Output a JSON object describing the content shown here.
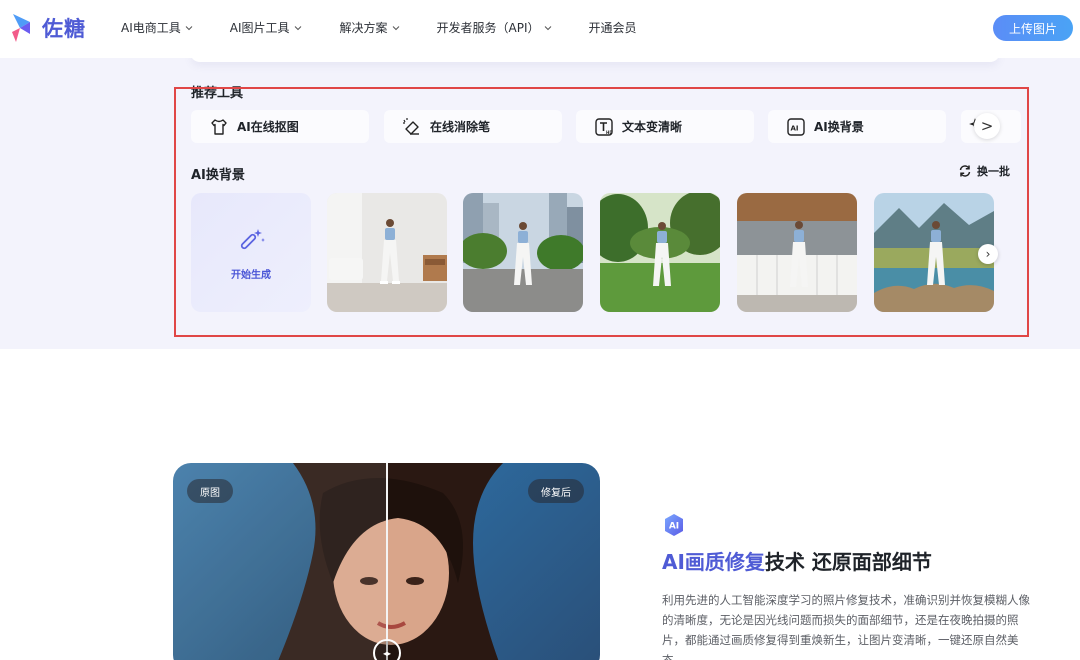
{
  "header": {
    "logo_text": "佐糖",
    "nav": [
      {
        "label": "AI电商工具",
        "has_dropdown": true
      },
      {
        "label": "AI图片工具",
        "has_dropdown": true
      },
      {
        "label": "解决方案",
        "has_dropdown": true
      },
      {
        "label": "开发者服务（API）",
        "has_dropdown": true
      },
      {
        "label": "开通会员",
        "has_dropdown": false
      }
    ],
    "upload_label": "上传图片"
  },
  "recommended": {
    "title": "推荐工具",
    "tools": [
      {
        "label": "AI在线抠图",
        "icon": "shirt-icon"
      },
      {
        "label": "在线消除笔",
        "icon": "eraser-icon"
      },
      {
        "label": "文本变清晰",
        "icon": "text-hd-icon"
      },
      {
        "label": "AI换背景",
        "icon": "ai-background-icon"
      },
      {
        "label": "",
        "icon": "sparkle-icon"
      }
    ],
    "scroll_arrow": ">"
  },
  "bg_swap": {
    "title": "AI换背景",
    "refresh_label": "换一批",
    "generate_label": "开始生成",
    "thumbnails": [
      "white-living-room",
      "city-street",
      "park-lawn",
      "modern-kitchen",
      "mountain-lake"
    ],
    "next_arrow": "›"
  },
  "compare": {
    "before_label": "原图",
    "after_label": "修复后",
    "handle_glyph": "◂▸"
  },
  "feature": {
    "badge": "AI",
    "title_accent": "AI画质修复",
    "title_rest": "技术 还原面部细节",
    "description": "利用先进的人工智能深度学习的照片修复技术，准确识别并恢复模糊人像的清晰度，无论是因光线问题而损失的面部细节，还是在夜晚拍摄的照片，都能通过画质修复得到重焕新生，让图片变清晰，一键还原自然美态。"
  },
  "colors": {
    "brand": "#4f5bd5",
    "band_bg": "#f3f3fc",
    "highlight_outline": "#e04646"
  }
}
